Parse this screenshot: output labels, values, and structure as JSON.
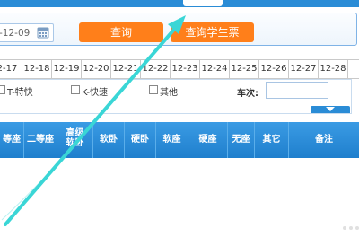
{
  "topbar": {
    "tabs": [
      {
        "label": "",
        "active": false
      },
      {
        "label": "",
        "active": false
      },
      {
        "label": "",
        "active": true
      },
      {
        "label": "",
        "active": false
      },
      {
        "label": "",
        "active": false
      }
    ]
  },
  "query": {
    "date_value": "-12-09",
    "calendar_icon": "calendar-icon",
    "query_button": "查询",
    "student_ticket_button": "查询学生票"
  },
  "date_strip": [
    "2-17",
    "12-18",
    "12-19",
    "12-20",
    "12-21",
    "12-22",
    "12-23",
    "12-24",
    "12-25",
    "12-26",
    "12-27",
    "12-28"
  ],
  "filters": {
    "options": [
      {
        "label": "T-特快",
        "checked": false
      },
      {
        "label": "K-快速",
        "checked": false
      },
      {
        "label": "其他",
        "checked": false
      }
    ],
    "train_no_label": "车次:",
    "train_no_value": "",
    "collapse_icon": "triangle-down-icon"
  },
  "table_header": {
    "columns": [
      "等座",
      "二等座",
      "高级软卧",
      "软卧",
      "硬卧",
      "软座",
      "硬座",
      "无座",
      "其它",
      "备注"
    ]
  },
  "colors": {
    "accent_blue": "#2a8cd6",
    "button_orange": "#ff7f1a",
    "annotation_arrow": "#3ad6d6"
  }
}
